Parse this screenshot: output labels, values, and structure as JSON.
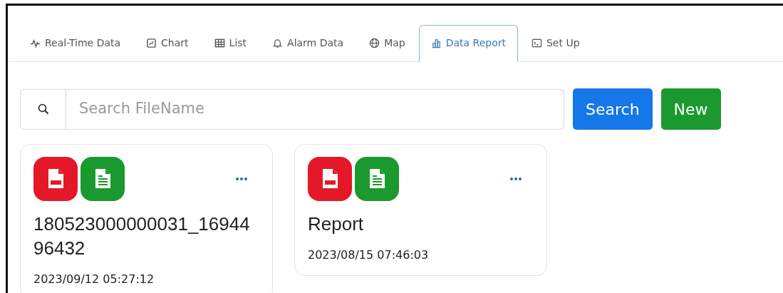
{
  "tabs": [
    {
      "label": "Real-Time Data",
      "selected": false
    },
    {
      "label": "Chart",
      "selected": false
    },
    {
      "label": "List",
      "selected": false
    },
    {
      "label": "Alarm Data",
      "selected": false
    },
    {
      "label": "Map",
      "selected": false
    },
    {
      "label": "Data Report",
      "selected": true
    },
    {
      "label": "Set Up",
      "selected": false
    }
  ],
  "search": {
    "placeholder": "Search FileName"
  },
  "buttons": [
    {
      "label": "Search",
      "kind": "primary"
    },
    {
      "label": "New",
      "kind": "success"
    }
  ],
  "reports": [
    {
      "name": "180523000000031_1694496432",
      "date": "2023/09/12 05:27:12"
    },
    {
      "name": "Report",
      "date": "2023/08/15 07:46:03"
    }
  ]
}
